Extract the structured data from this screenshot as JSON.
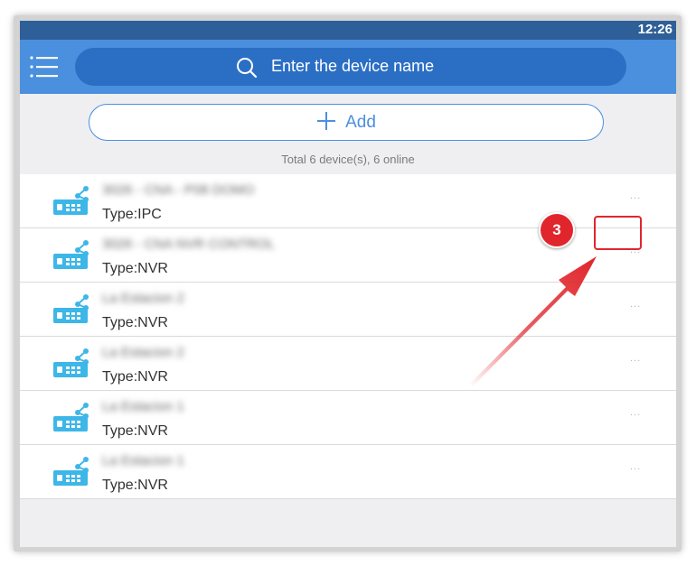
{
  "status_bar": {
    "time": "12:26"
  },
  "app_bar": {
    "menu_icon": "hamburger-menu-icon",
    "search": {
      "icon": "search-icon",
      "placeholder": "Enter the device name"
    }
  },
  "add_button": {
    "icon": "plus-icon",
    "label": "Add"
  },
  "summary": {
    "text": "Total 6 device(s), 6 online"
  },
  "devices": [
    {
      "name": "3026 - CNA - P08 DOMO",
      "type": "Type:IPC",
      "more": "..."
    },
    {
      "name": "3026 - CNA NVR CONTROL",
      "type": "Type:NVR",
      "more": "..."
    },
    {
      "name": "La Estacion 2",
      "type": "Type:NVR",
      "more": "..."
    },
    {
      "name": "La Estacion 2",
      "type": "Type:NVR",
      "more": "..."
    },
    {
      "name": "La Estacion 1",
      "type": "Type:NVR",
      "more": "..."
    },
    {
      "name": "La Estacion 1",
      "type": "Type:NVR",
      "more": "..."
    }
  ],
  "annotation": {
    "step_number": "3",
    "color": "#e0262c"
  },
  "colors": {
    "status_bar": "#2e5f98",
    "app_bar": "#4a90de",
    "search_box": "#2b6fc5",
    "accent": "#4a90de",
    "device_icon": "#3db6e8"
  }
}
